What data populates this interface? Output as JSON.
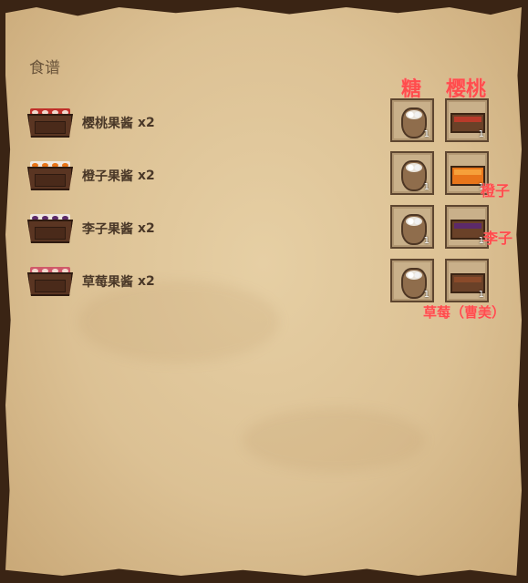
{
  "panel": {
    "title": "食谱"
  },
  "recipes": [
    {
      "label": "樱桃果酱",
      "qty": "x2",
      "fruit_color": "#c0302a"
    },
    {
      "label": "橙子果酱",
      "qty": "x2",
      "fruit_color": "#e8751a"
    },
    {
      "label": "李子果酱",
      "qty": "x2",
      "fruit_color": "#5c2a6a"
    },
    {
      "label": "草莓果酱",
      "qty": "x2",
      "fruit_color": "#a8402c"
    }
  ],
  "ingredients": [
    {
      "sugar_count": "1",
      "fruit_count": "1"
    },
    {
      "sugar_count": "1",
      "fruit_count": "1"
    },
    {
      "sugar_count": "1",
      "fruit_count": "1"
    },
    {
      "sugar_count": "1",
      "fruit_count": "1"
    }
  ],
  "annotations": {
    "sugar": "糖",
    "cherry": "樱桃",
    "orange": "橙子",
    "plum": "李子",
    "strawberry": "草莓（曹美）"
  },
  "colors": {
    "annotation": "#ff4d4d",
    "parchment": "#dcc194",
    "frame": "#3a2414"
  }
}
